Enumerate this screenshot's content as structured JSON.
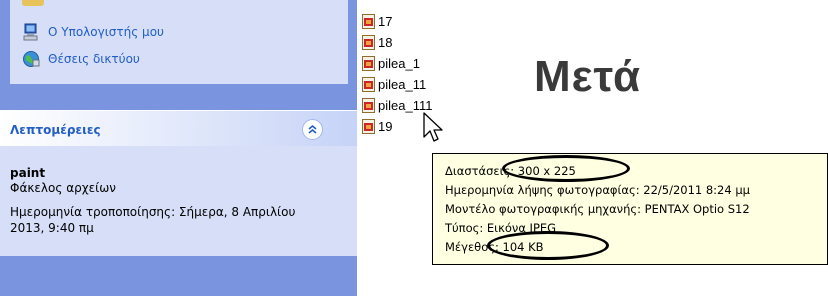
{
  "sidebar": {
    "places": [
      {
        "label": "Ο Υπολογιστής μου",
        "icon": "my-computer-icon"
      },
      {
        "label": "Θέσεις δικτύου",
        "icon": "network-places-icon"
      }
    ],
    "details": {
      "title": "Λεπτομέρειες",
      "name": "paint",
      "type": "Φάκελος αρχείων",
      "modified": "Ημερομηνία τροποποίησης: Σήμερα, 8 Απριλίου 2013, 9:40 πμ"
    }
  },
  "files": [
    {
      "name": "17",
      "icon": "image-file-icon"
    },
    {
      "name": "18",
      "icon": "image-file-icon"
    },
    {
      "name": "pilea_1",
      "icon": "image-file-icon"
    },
    {
      "name": "pilea_11",
      "icon": "image-file-icon"
    },
    {
      "name": "pilea_111",
      "icon": "image-file-icon"
    },
    {
      "name": "19",
      "icon": "image-file-icon"
    }
  ],
  "caption": "Μετά",
  "tooltip": {
    "dimensions": "Διαστάσεις: 300 x 225",
    "date_taken": "Ημερομηνία λήψης φωτογραφίας: 22/5/2011 8:24 μμ",
    "camera_model": "Μοντέλο φωτογραφικής μηχανής: PENTAX Optio S12",
    "type": "Τύπος: Εικόνα JPEG",
    "size": "Μέγεθος: 104 KB"
  },
  "colors": {
    "pane_background": "#7b94e0",
    "panel_background": "#d6dff7",
    "link_text": "#215dc6",
    "tooltip_background": "#ffffe1",
    "annotation_ellipse": "#000000"
  }
}
